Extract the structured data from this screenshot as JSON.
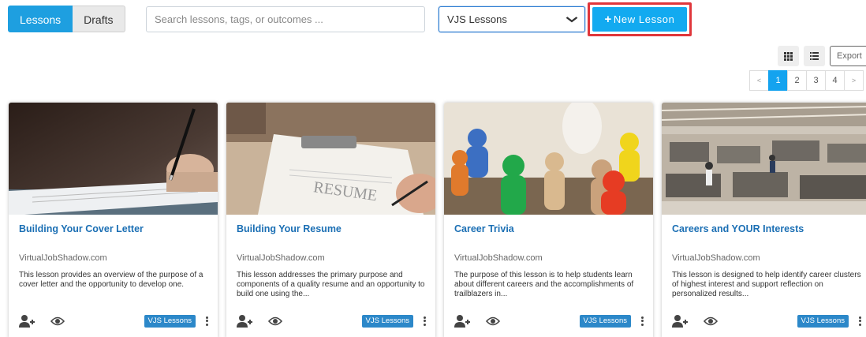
{
  "tabs": {
    "lessons": "Lessons",
    "drafts": "Drafts"
  },
  "search": {
    "placeholder": "Search lessons, tags, or outcomes ..."
  },
  "filter": {
    "selected": "VJS Lessons"
  },
  "new_lesson": {
    "plus": "+",
    "label": "New Lesson"
  },
  "export_label": "Export",
  "pagination": {
    "prev": "<",
    "pages": [
      "1",
      "2",
      "3",
      "4"
    ],
    "next": ">",
    "current": "1"
  },
  "icons": {
    "grid_view": "grid-view-icon",
    "list_view": "list-view-icon",
    "assign": "user-plus-icon",
    "preview": "eye-icon",
    "more": "kebab-menu-icon",
    "chevron": "chevron-down-icon"
  },
  "colors": {
    "primary": "#1e9fe0",
    "new_button": "#12aaf0",
    "highlight_border": "#e0363b",
    "title_link": "#1b6fb4",
    "badge": "#2c88c9"
  },
  "cards": [
    {
      "title": "Building Your Cover Letter",
      "source": "VirtualJobShadow.com",
      "description": "This lesson provides an overview of the purpose of a cover letter and the opportunity to develop one.",
      "badge": "VJS Lessons"
    },
    {
      "title": "Building Your Resume",
      "source": "VirtualJobShadow.com",
      "description": "This lesson addresses the primary purpose and components of a quality resume and an opportunity to build one using the...",
      "badge": "VJS Lessons"
    },
    {
      "title": "Career Trivia",
      "source": "VirtualJobShadow.com",
      "description": "The purpose of this lesson is to help students learn about different careers and the accomplishments of trailblazers in...",
      "badge": "VJS Lessons"
    },
    {
      "title": "Careers and YOUR Interests",
      "source": "VirtualJobShadow.com",
      "description": "This lesson is designed to help identify career clusters of highest interest and support reflection on personalized results...",
      "badge": "VJS Lessons"
    }
  ]
}
